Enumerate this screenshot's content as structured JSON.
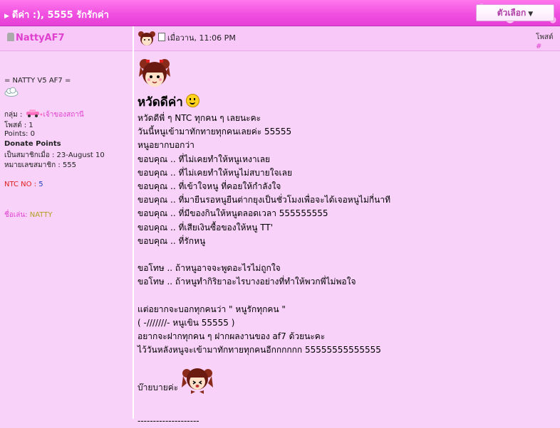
{
  "topbar": {
    "title": "ดีค่า :), 5555 รักรักค่า",
    "options_label": "ตัวเลือก"
  },
  "post_header": {
    "username": "NattyAF7",
    "timestamp": "เมื่อวาน, 11:06 PM",
    "post_label": "โพสต์",
    "post_label_hash": "#"
  },
  "profile": {
    "tagline": "= NATTY V5 AF7 =",
    "group_label": "กลุ่ม :",
    "group_value": "เจ้าของสถานี",
    "posts_line": "โพสต์ : 1",
    "points_line": "Points: 0",
    "donate": "Donate Points",
    "joined_line": "เป็นสมาชิกเมื่อ : 23-August 10",
    "member_no_line": "หมายเลขสมาชิก : 555",
    "ntc_label": "NTC NO :",
    "ntc_value": "5",
    "nickname_label": "ชื่อเล่น:",
    "nickname_value": "NATTY"
  },
  "post": {
    "heading": "หวัดดีค่า",
    "lines": [
      "หวัดดีพี่ ๆ NTC ทุกคน ๆ เลยนะคะ",
      "วันนี้หนูเข้ามาทักทายทุกคนเลยค่ะ 55555",
      "หนูอยากบอกว่า",
      "ขอบคุณ .. ที่ไม่เคยทำให้หนูเหงาเลย",
      "ขอบคุณ .. ที่ไม่เคยทำให้หนูไม่สบายใจเลย",
      "ขอบคุณ .. ที่เข้าใจหนู ที่คอยให้กำลังใจ",
      "ขอบคุณ .. ที่มายืนรอหนูยืนต่ากยุงเป็นชั่วโมงเพื่อจะได้เจอหนูไม่กี่นาที",
      "ขอบคุณ .. ที่มีของกินให้หนูตลอดเวลา 555555555",
      "ขอบคุณ .. ที่เสียเงินซื้อของให้หนู TT'",
      "ขอบคุณ .. ที่รักหนู",
      "",
      "ขอโทษ .. ถ้าหนูอาจจะพูดอะไรไม่ถูกใจ",
      "ขอโทษ .. ถ้าหนูทำกิริยาอะไรบางอย่างที่ทำให้พวกพี่ไม่พอใจ",
      "",
      "แต่อยากจะบอกทุกคนว่า \" หนูรักทุกคน \"",
      "( -///////- หนูเขิน 55555 )",
      "อยากจะฝากทุกคน ๆ ฝากผลงานของ af7 ด้วยนะคะ",
      "ไว้วันหลังหนูจะเข้ามาทักทายทุกคนอีกกกกกก 55555555555555"
    ],
    "bye": "บ๊ายบายค่ะ",
    "separator": "--------------------"
  }
}
